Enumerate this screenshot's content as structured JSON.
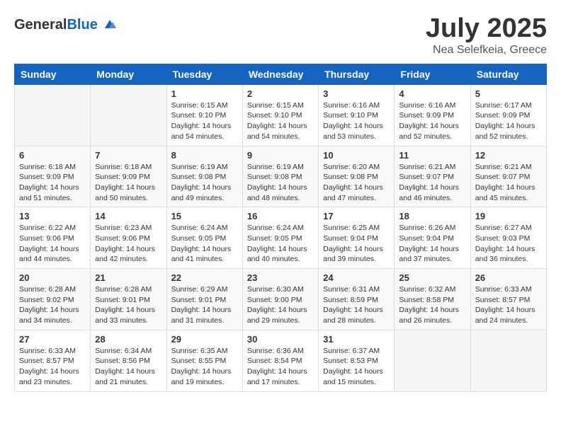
{
  "header": {
    "logo_general": "General",
    "logo_blue": "Blue",
    "title": "July 2025",
    "subtitle": "Nea Selefkeia, Greece"
  },
  "calendar": {
    "days_of_week": [
      "Sunday",
      "Monday",
      "Tuesday",
      "Wednesday",
      "Thursday",
      "Friday",
      "Saturday"
    ],
    "weeks": [
      [
        {
          "day": "",
          "detail": ""
        },
        {
          "day": "",
          "detail": ""
        },
        {
          "day": "1",
          "detail": "Sunrise: 6:15 AM\nSunset: 9:10 PM\nDaylight: 14 hours and 54 minutes."
        },
        {
          "day": "2",
          "detail": "Sunrise: 6:15 AM\nSunset: 9:10 PM\nDaylight: 14 hours and 54 minutes."
        },
        {
          "day": "3",
          "detail": "Sunrise: 6:16 AM\nSunset: 9:10 PM\nDaylight: 14 hours and 53 minutes."
        },
        {
          "day": "4",
          "detail": "Sunrise: 6:16 AM\nSunset: 9:09 PM\nDaylight: 14 hours and 52 minutes."
        },
        {
          "day": "5",
          "detail": "Sunrise: 6:17 AM\nSunset: 9:09 PM\nDaylight: 14 hours and 52 minutes."
        }
      ],
      [
        {
          "day": "6",
          "detail": "Sunrise: 6:18 AM\nSunset: 9:09 PM\nDaylight: 14 hours and 51 minutes."
        },
        {
          "day": "7",
          "detail": "Sunrise: 6:18 AM\nSunset: 9:09 PM\nDaylight: 14 hours and 50 minutes."
        },
        {
          "day": "8",
          "detail": "Sunrise: 6:19 AM\nSunset: 9:08 PM\nDaylight: 14 hours and 49 minutes."
        },
        {
          "day": "9",
          "detail": "Sunrise: 6:19 AM\nSunset: 9:08 PM\nDaylight: 14 hours and 48 minutes."
        },
        {
          "day": "10",
          "detail": "Sunrise: 6:20 AM\nSunset: 9:08 PM\nDaylight: 14 hours and 47 minutes."
        },
        {
          "day": "11",
          "detail": "Sunrise: 6:21 AM\nSunset: 9:07 PM\nDaylight: 14 hours and 46 minutes."
        },
        {
          "day": "12",
          "detail": "Sunrise: 6:21 AM\nSunset: 9:07 PM\nDaylight: 14 hours and 45 minutes."
        }
      ],
      [
        {
          "day": "13",
          "detail": "Sunrise: 6:22 AM\nSunset: 9:06 PM\nDaylight: 14 hours and 44 minutes."
        },
        {
          "day": "14",
          "detail": "Sunrise: 6:23 AM\nSunset: 9:06 PM\nDaylight: 14 hours and 42 minutes."
        },
        {
          "day": "15",
          "detail": "Sunrise: 6:24 AM\nSunset: 9:05 PM\nDaylight: 14 hours and 41 minutes."
        },
        {
          "day": "16",
          "detail": "Sunrise: 6:24 AM\nSunset: 9:05 PM\nDaylight: 14 hours and 40 minutes."
        },
        {
          "day": "17",
          "detail": "Sunrise: 6:25 AM\nSunset: 9:04 PM\nDaylight: 14 hours and 39 minutes."
        },
        {
          "day": "18",
          "detail": "Sunrise: 6:26 AM\nSunset: 9:04 PM\nDaylight: 14 hours and 37 minutes."
        },
        {
          "day": "19",
          "detail": "Sunrise: 6:27 AM\nSunset: 9:03 PM\nDaylight: 14 hours and 36 minutes."
        }
      ],
      [
        {
          "day": "20",
          "detail": "Sunrise: 6:28 AM\nSunset: 9:02 PM\nDaylight: 14 hours and 34 minutes."
        },
        {
          "day": "21",
          "detail": "Sunrise: 6:28 AM\nSunset: 9:01 PM\nDaylight: 14 hours and 33 minutes."
        },
        {
          "day": "22",
          "detail": "Sunrise: 6:29 AM\nSunset: 9:01 PM\nDaylight: 14 hours and 31 minutes."
        },
        {
          "day": "23",
          "detail": "Sunrise: 6:30 AM\nSunset: 9:00 PM\nDaylight: 14 hours and 29 minutes."
        },
        {
          "day": "24",
          "detail": "Sunrise: 6:31 AM\nSunset: 8:59 PM\nDaylight: 14 hours and 28 minutes."
        },
        {
          "day": "25",
          "detail": "Sunrise: 6:32 AM\nSunset: 8:58 PM\nDaylight: 14 hours and 26 minutes."
        },
        {
          "day": "26",
          "detail": "Sunrise: 6:33 AM\nSunset: 8:57 PM\nDaylight: 14 hours and 24 minutes."
        }
      ],
      [
        {
          "day": "27",
          "detail": "Sunrise: 6:33 AM\nSunset: 8:57 PM\nDaylight: 14 hours and 23 minutes."
        },
        {
          "day": "28",
          "detail": "Sunrise: 6:34 AM\nSunset: 8:56 PM\nDaylight: 14 hours and 21 minutes."
        },
        {
          "day": "29",
          "detail": "Sunrise: 6:35 AM\nSunset: 8:55 PM\nDaylight: 14 hours and 19 minutes."
        },
        {
          "day": "30",
          "detail": "Sunrise: 6:36 AM\nSunset: 8:54 PM\nDaylight: 14 hours and 17 minutes."
        },
        {
          "day": "31",
          "detail": "Sunrise: 6:37 AM\nSunset: 8:53 PM\nDaylight: 14 hours and 15 minutes."
        },
        {
          "day": "",
          "detail": ""
        },
        {
          "day": "",
          "detail": ""
        }
      ]
    ]
  }
}
